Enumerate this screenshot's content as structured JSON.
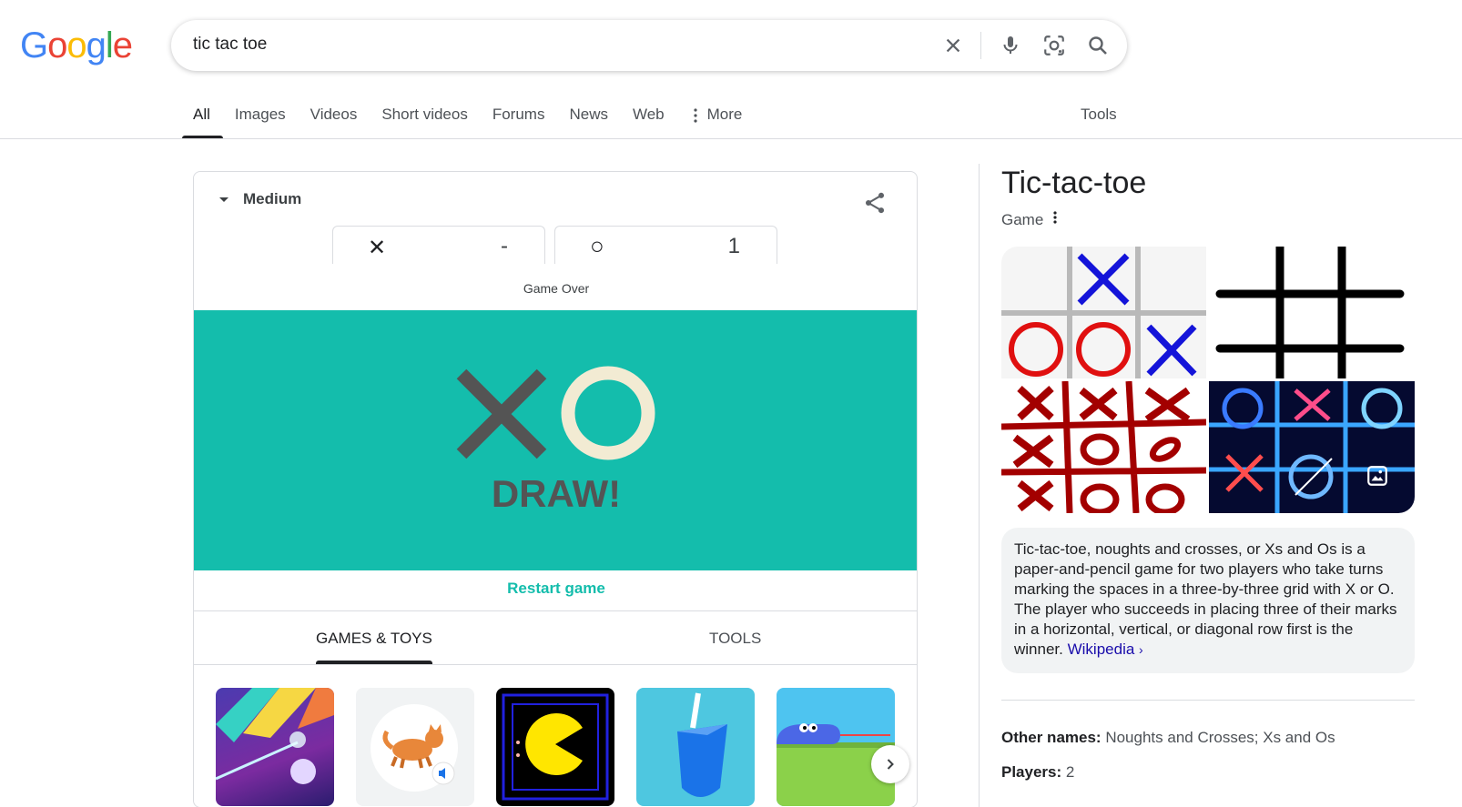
{
  "header": {
    "logo_letters": [
      "G",
      "o",
      "o",
      "g",
      "l",
      "e"
    ],
    "logo_colors": [
      "#4285F4",
      "#EA4335",
      "#FBBC05",
      "#4285F4",
      "#34A853",
      "#EA4335"
    ],
    "search_query": "tic tac toe",
    "icons": [
      "close-icon",
      "microphone-icon",
      "lens-icon",
      "search-icon"
    ]
  },
  "tabs": {
    "items": [
      {
        "label": "All",
        "active": true
      },
      {
        "label": "Images"
      },
      {
        "label": "Videos"
      },
      {
        "label": "Short videos"
      },
      {
        "label": "Forums"
      },
      {
        "label": "News"
      },
      {
        "label": "Web"
      },
      {
        "label": "More"
      }
    ],
    "tools": "Tools"
  },
  "game": {
    "difficulty": "Medium",
    "score_x_mark": "✕",
    "score_x_value": "-",
    "score_o_mark": "○",
    "score_o_value": "1",
    "status": "Game Over",
    "result": "DRAW!",
    "board_color": "#14bdac",
    "restart_label": "Restart game",
    "subtabs": [
      {
        "label": "GAMES & TOYS",
        "active": true
      },
      {
        "label": "TOOLS"
      }
    ],
    "thumbnails": [
      "color-bounce",
      "cat-sound",
      "pac-man",
      "spinner",
      "snake"
    ]
  },
  "knowledge_panel": {
    "title": "Tic-tac-toe",
    "subtitle": "Game",
    "description": "Tic-tac-toe, noughts and crosses, or Xs and Os is a paper-and-pencil game for two players who take turns marking the spaces in a three-by-three grid with X or O. The player who succeeds in placing three of their marks in a horizontal, vertical, or diagonal row first is the winner.",
    "source_link": "Wikipedia",
    "facts": [
      {
        "label": "Other names:",
        "value": "Noughts and Crosses; Xs and Os"
      },
      {
        "label": "Players:",
        "value": "2"
      }
    ]
  }
}
